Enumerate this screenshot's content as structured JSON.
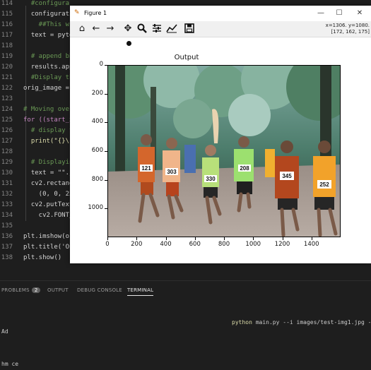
{
  "editor": {
    "lines": [
      {
        "num": "114",
        "text": "  #configura",
        "cls": "cmt"
      },
      {
        "num": "115",
        "text": "  configurati",
        "cls": ""
      },
      {
        "num": "116",
        "text": "    ##This wi",
        "cls": "cmt"
      },
      {
        "num": "117",
        "text": "  text = pyte",
        "cls": ""
      },
      {
        "num": "118",
        "text": "",
        "cls": ""
      },
      {
        "num": "119",
        "text": "  # append bb",
        "cls": "cmt"
      },
      {
        "num": "120",
        "text": "  results.app",
        "cls": ""
      },
      {
        "num": "121",
        "text": "  #Display th",
        "cls": "cmt"
      },
      {
        "num": "122",
        "text": "orig_image =",
        "cls": ""
      },
      {
        "num": "123",
        "text": "",
        "cls": ""
      },
      {
        "num": "124",
        "text": "# Moving over",
        "cls": "cmt"
      },
      {
        "num": "125",
        "text": "for ((start_x",
        "cls": "kw"
      },
      {
        "num": "126",
        "text": "  # display t",
        "cls": "cmt"
      },
      {
        "num": "127",
        "text": "  print(\"{}\\",
        "cls": "fn"
      },
      {
        "num": "128",
        "text": "",
        "cls": ""
      },
      {
        "num": "129",
        "text": "  # Displayin",
        "cls": "cmt"
      },
      {
        "num": "130",
        "text": "  text = \"\".j",
        "cls": ""
      },
      {
        "num": "131",
        "text": "  cv2.rectang",
        "cls": ""
      },
      {
        "num": "132",
        "text": "    (0, 0, 25",
        "cls": ""
      },
      {
        "num": "133",
        "text": "  cv2.putText",
        "cls": ""
      },
      {
        "num": "134",
        "text": "    cv2.FONT_",
        "cls": ""
      },
      {
        "num": "135",
        "text": "",
        "cls": ""
      },
      {
        "num": "136",
        "text": "plt.imshow(or",
        "cls": ""
      },
      {
        "num": "137",
        "text": "plt.title('Ou",
        "cls": ""
      },
      {
        "num": "138",
        "text": "plt.show()",
        "cls": ""
      }
    ]
  },
  "panel": {
    "tabs": [
      {
        "label": "PROBLEMS",
        "badge": "2"
      },
      {
        "label": "OUTPUT"
      },
      {
        "label": "DEBUG CONSOLE"
      },
      {
        "label": "TERMINAL"
      }
    ],
    "terminal": {
      "cmd_prefix": "python",
      "cmd_rest": " main.py --i images/test-img1.jpg -",
      "line1": "Ad",
      "line2": "hm ce"
    }
  },
  "figure": {
    "title": "Figure 1",
    "coords_line1": "x=1306. y=1080.",
    "coords_line2": "[172, 162, 175]",
    "plot_title": "Output",
    "toolbar_icons": [
      "home-icon",
      "back-icon",
      "forward-icon",
      "pan-icon",
      "zoom-icon",
      "configure-icon",
      "edit-curve-icon",
      "save-icon"
    ],
    "yticks": [
      "0",
      "200",
      "400",
      "600",
      "800",
      "1000"
    ],
    "xticks": [
      "0",
      "200",
      "400",
      "600",
      "800",
      "1000",
      "1200",
      "1400"
    ]
  },
  "image": {
    "bibs": [
      "121",
      "303",
      "330",
      "345",
      "252",
      "208"
    ]
  }
}
